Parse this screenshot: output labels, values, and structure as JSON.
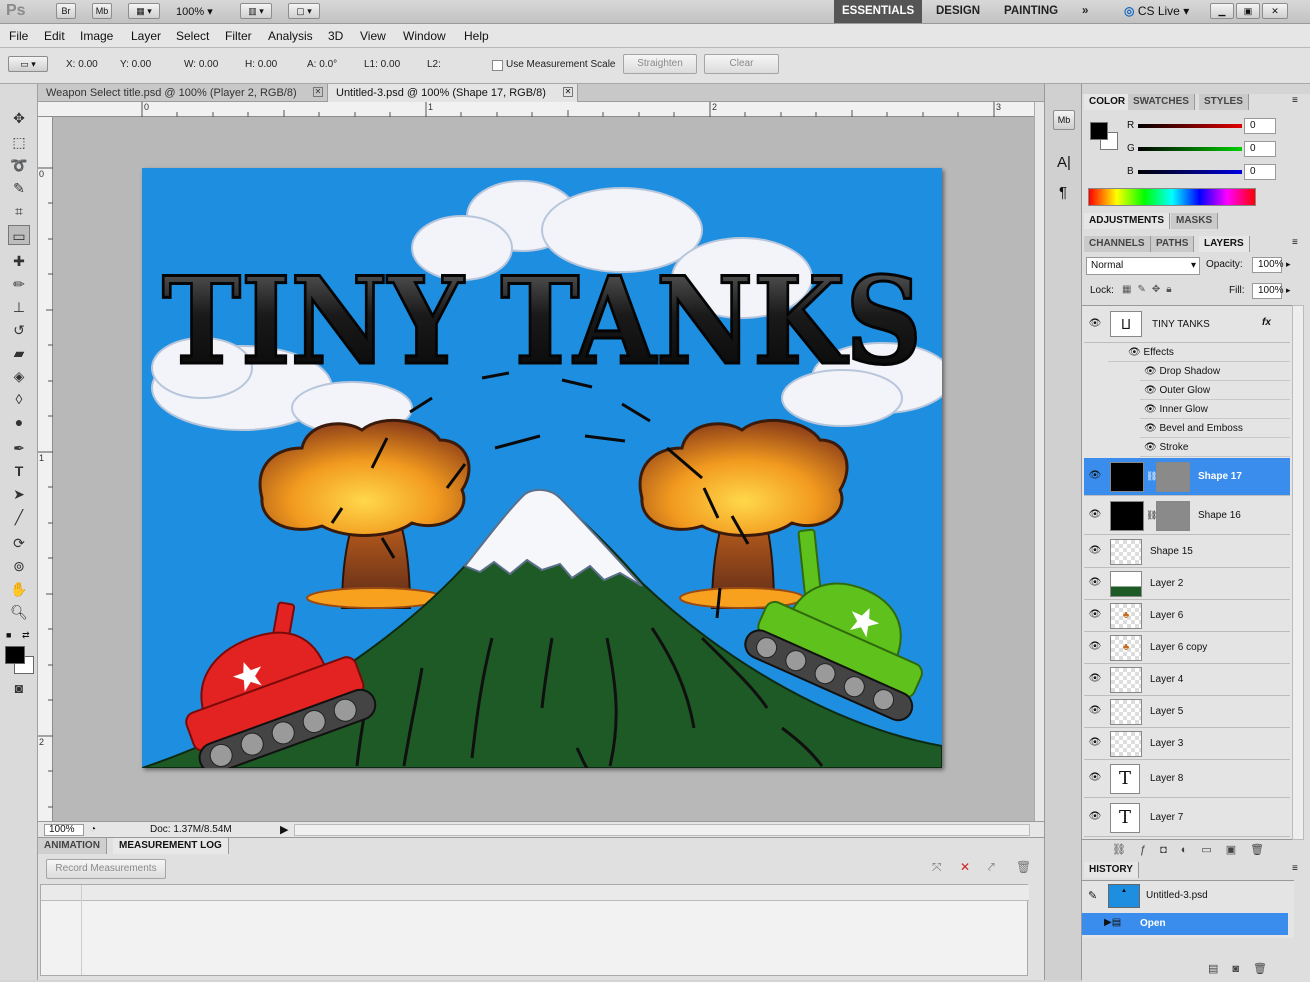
{
  "app": {
    "logo": "Ps",
    "bridge": "Br",
    "mini_bridge": "Mb",
    "zoom": "100%",
    "workspaces": [
      "ESSENTIALS",
      "DESIGN",
      "PAINTING"
    ],
    "active_workspace": "ESSENTIALS",
    "cs_live": "CS Live"
  },
  "menu": [
    "File",
    "Edit",
    "Image",
    "Layer",
    "Select",
    "Filter",
    "Analysis",
    "3D",
    "View",
    "Window",
    "Help"
  ],
  "options": {
    "x": "X: 0.00",
    "y": "Y: 0.00",
    "w": "W: 0.00",
    "h": "H: 0.00",
    "a": "A: 0.0°",
    "l1": "L1: 0.00",
    "l2": "L2:",
    "measurement_scale": "Use Measurement Scale",
    "straighten": "Straighten",
    "clear": "Clear"
  },
  "doc_tabs": [
    {
      "label": "Weapon Select title.psd @ 100% (Player 2, RGB/8)",
      "active": false
    },
    {
      "label": "Untitled-3.psd @ 100% (Shape 17, RGB/8)",
      "active": true
    }
  ],
  "ruler": {
    "top": [
      "0",
      "1",
      "2",
      "3"
    ],
    "left": [
      "0",
      "1",
      "2"
    ]
  },
  "artwork": {
    "title_text": "TINY TANKS",
    "sky_color": "#1e8fe0",
    "mountain_color": "#1e5a26",
    "red_tank_color": "#e32222",
    "green_tank_color": "#5fc11c"
  },
  "status": {
    "zoom": "100%",
    "doc": "Doc: 1.37M/8.54M"
  },
  "bottom_panel": {
    "tabs": [
      "ANIMATION",
      "MEASUREMENT LOG"
    ],
    "active": "MEASUREMENT LOG",
    "record_button": "Record Measurements"
  },
  "color_panel": {
    "tabs": [
      "COLOR",
      "SWATCHES",
      "STYLES"
    ],
    "channels": [
      {
        "label": "R",
        "value": "0"
      },
      {
        "label": "G",
        "value": "0"
      },
      {
        "label": "B",
        "value": "0"
      }
    ]
  },
  "adjust_tabs": [
    "ADJUSTMENTS",
    "MASKS"
  ],
  "layers_panel": {
    "tabs": [
      "CHANNELS",
      "PATHS",
      "LAYERS"
    ],
    "blend_mode": "Normal",
    "opacity_label": "Opacity:",
    "opacity": "100%",
    "lock_label": "Lock:",
    "fill_label": "Fill:",
    "fill": "100%",
    "top_layer": {
      "name": "TINY TANKS",
      "fx": "fx",
      "effects_label": "Effects",
      "effects": [
        "Drop Shadow",
        "Outer Glow",
        "Inner Glow",
        "Bevel and Emboss",
        "Stroke"
      ]
    },
    "layers": [
      {
        "name": "Shape 17",
        "selected": true,
        "kind": "shape"
      },
      {
        "name": "Shape 16",
        "selected": false,
        "kind": "shape"
      },
      {
        "name": "Shape 15",
        "selected": false,
        "kind": "blank"
      },
      {
        "name": "Layer 2",
        "selected": false,
        "kind": "hill"
      },
      {
        "name": "Layer 6",
        "selected": false,
        "kind": "cloud"
      },
      {
        "name": "Layer 6 copy",
        "selected": false,
        "kind": "cloud"
      },
      {
        "name": "Layer 4",
        "selected": false,
        "kind": "blank"
      },
      {
        "name": "Layer 5",
        "selected": false,
        "kind": "blank"
      },
      {
        "name": "Layer 3",
        "selected": false,
        "kind": "blank"
      },
      {
        "name": "Layer 8",
        "selected": false,
        "kind": "text"
      },
      {
        "name": "Layer 7",
        "selected": false,
        "kind": "text"
      }
    ]
  },
  "history": {
    "tab": "HISTORY",
    "snapshot": "Untitled-3.psd",
    "items": [
      {
        "label": "Open",
        "selected": true
      }
    ]
  }
}
